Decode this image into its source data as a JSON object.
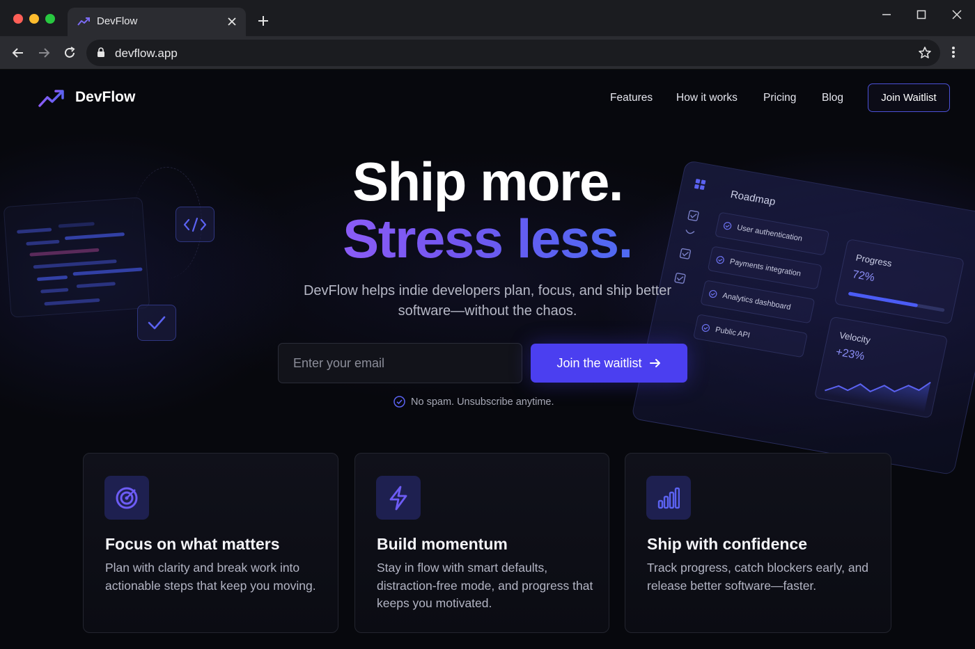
{
  "browser": {
    "tab_title": "DevFlow",
    "url": "devflow.app"
  },
  "nav": {
    "brand": "DevFlow",
    "links": [
      "Features",
      "How it works",
      "Pricing",
      "Blog"
    ],
    "cta": "Join Waitlist"
  },
  "hero": {
    "headline_1": "Ship more.",
    "headline_2": "Stress less.",
    "subtitle": "DevFlow helps indie developers plan, focus, and ship better software—without the chaos.",
    "email_placeholder": "Enter your email",
    "cta": "Join the waitlist",
    "note": "No spam. Unsubscribe anytime."
  },
  "dashboard": {
    "title": "Roadmap",
    "items": [
      "User authentication",
      "Payments integration",
      "Analytics dashboard",
      "Public API"
    ],
    "progress_label": "Progress",
    "progress_value": "72%",
    "progress_fraction": 0.72,
    "velocity_label": "Velocity",
    "velocity_value": "+23%"
  },
  "features": [
    {
      "icon": "target-icon",
      "title": "Focus on what matters",
      "text": "Plan with clarity and break work into actionable steps that keep you moving."
    },
    {
      "icon": "lightning-icon",
      "title": "Build momentum",
      "text": "Stay in flow with smart defaults, distraction-free mode, and progress that keeps you motivated."
    },
    {
      "icon": "bar-chart-icon",
      "title": "Ship with confidence",
      "text": "Track progress, catch blockers early, and release better software—faster."
    }
  ],
  "colors": {
    "accent": "#4b3ff0",
    "gradient_start": "#8b5cf6",
    "gradient_end": "#4f6bf2",
    "background": "#07080d"
  }
}
